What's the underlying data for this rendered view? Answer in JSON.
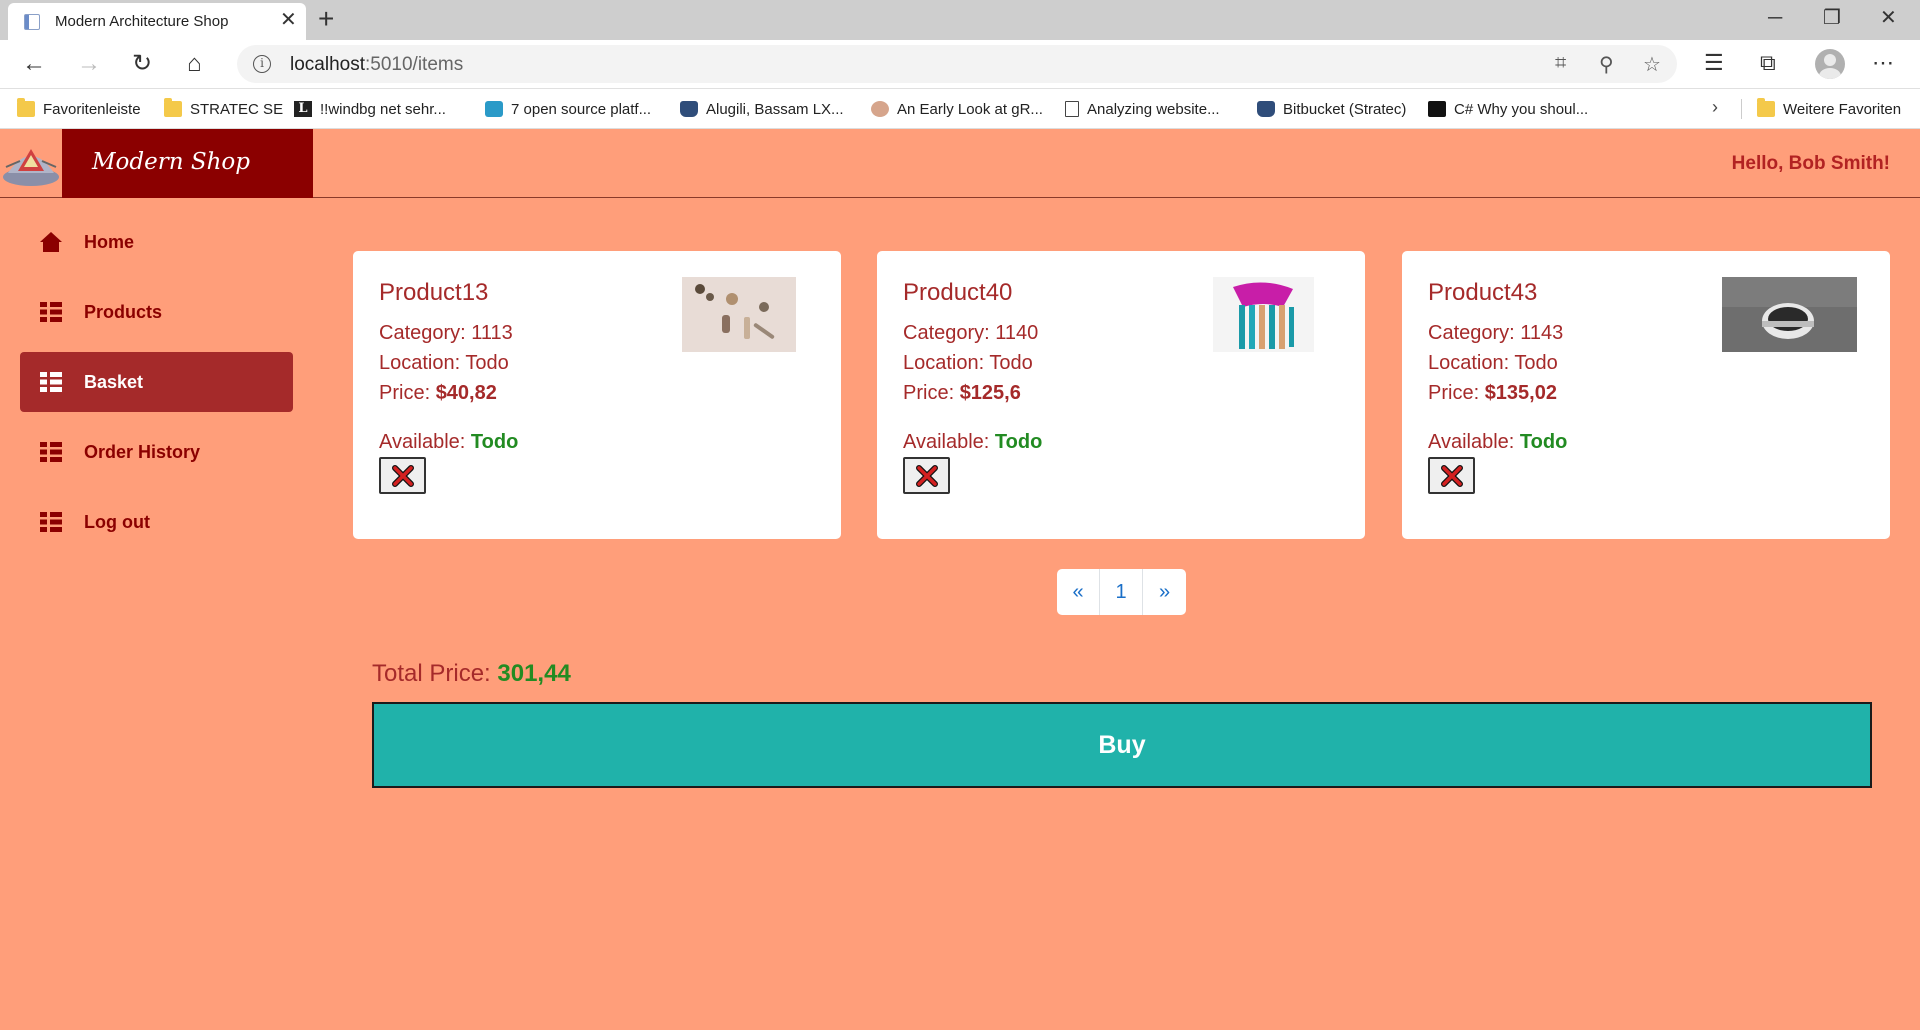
{
  "browser": {
    "tab_title": "Modern Architecture Shop",
    "url_host": "localhost",
    "url_path": ":5010/items",
    "bookmarks": [
      {
        "label": "Favoritenleiste",
        "icon": "folder-icon"
      },
      {
        "label": "STRATEC SE",
        "icon": "folder-icon"
      },
      {
        "label": "!!windbg  net sehr...",
        "icon": "l-logo-icon"
      },
      {
        "label": "7 open source platf...",
        "icon": "gear-logo-icon"
      },
      {
        "label": "Alugili, Bassam   LX...",
        "icon": "bitbucket-icon"
      },
      {
        "label": "An Early Look at gR...",
        "icon": "person-avatar-icon"
      },
      {
        "label": "Analyzing website...",
        "icon": "document-icon"
      },
      {
        "label": "Bitbucket (Stratec)",
        "icon": "bitbucket-icon"
      },
      {
        "label": "C#  Why you shoul...",
        "icon": "medium-logo-icon"
      }
    ],
    "other_favorites": "Weitere Favoriten"
  },
  "app": {
    "brand": "Modern Shop",
    "greeting": "Hello, Bob Smith!",
    "nav": [
      {
        "label": "Home",
        "icon": "home-icon",
        "active": false
      },
      {
        "label": "Products",
        "icon": "list-icon",
        "active": false
      },
      {
        "label": "Basket",
        "icon": "list-icon",
        "active": true
      },
      {
        "label": "Order History",
        "icon": "list-icon",
        "active": false
      },
      {
        "label": "Log out",
        "icon": "list-icon",
        "active": false
      }
    ],
    "labels": {
      "category": "Category: ",
      "location": "Location: ",
      "price": "Price: ",
      "available": "Available: "
    },
    "products": [
      {
        "name": "Product13",
        "category": "1113",
        "location": "Todo",
        "price": "$40,82",
        "available": "Todo"
      },
      {
        "name": "Product40",
        "category": "1140",
        "location": "Todo",
        "price": "$125,6",
        "available": "Todo"
      },
      {
        "name": "Product43",
        "category": "1143",
        "location": "Todo",
        "price": "$135,02",
        "available": "Todo"
      }
    ],
    "pagination": {
      "prev": "«",
      "current": "1",
      "next": "»"
    },
    "total_label": "Total Price: ",
    "total_value": "301,44",
    "buy_label": "Buy",
    "colors": {
      "page_bg": "#ff9e7a",
      "brand_bg": "#8b0000",
      "accent_text": "#a52a2a",
      "available_green": "#228b22",
      "buy_button": "#20b2aa"
    }
  }
}
